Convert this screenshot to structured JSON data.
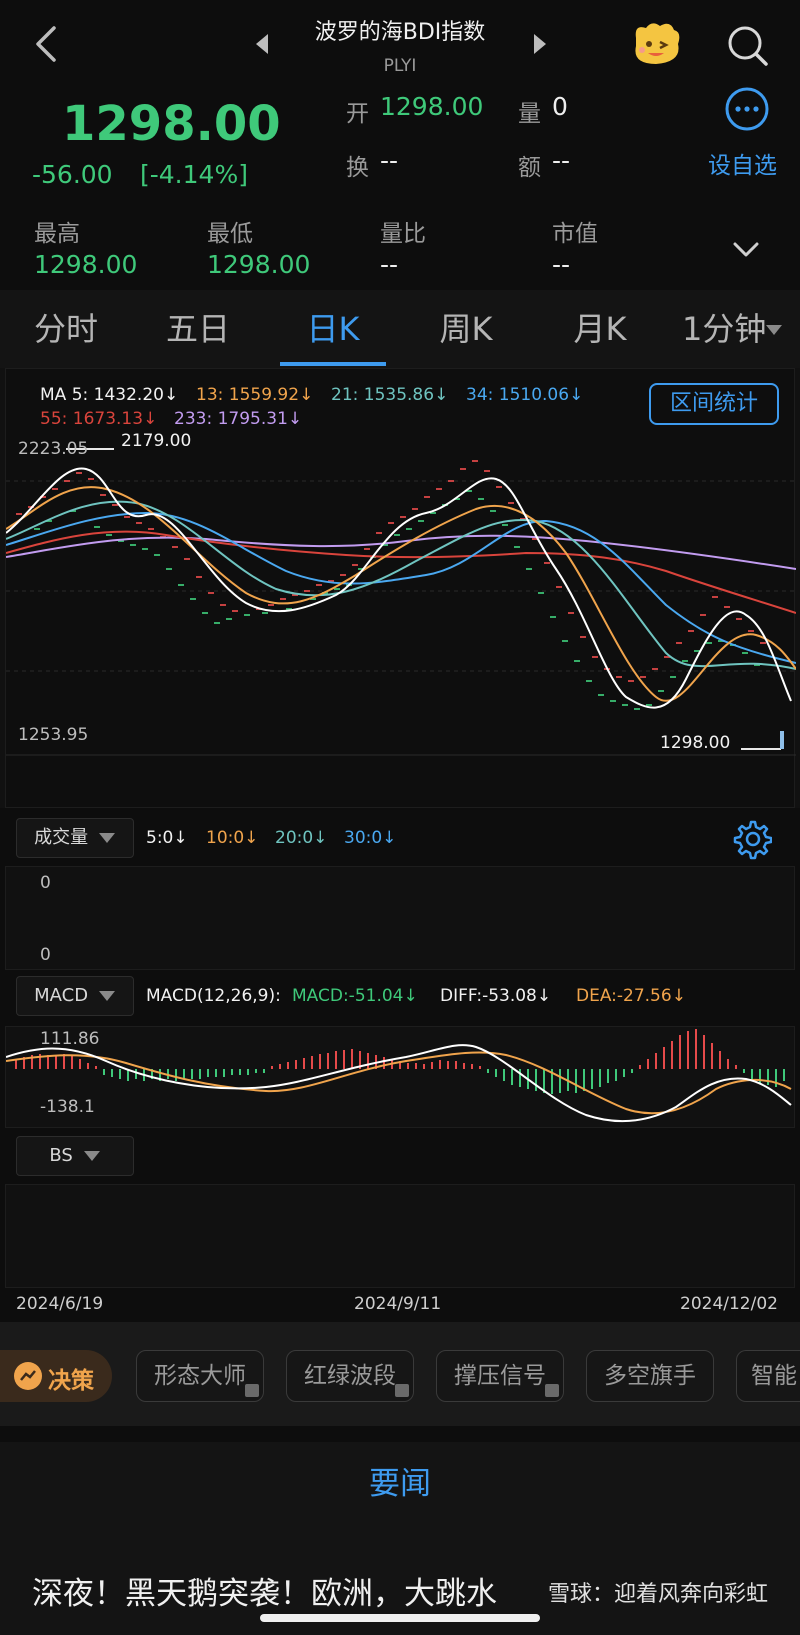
{
  "nav": {
    "title": "波罗的海BDI指数",
    "code": "PLYI"
  },
  "quote": {
    "price": "1298.00",
    "change": "-56.00",
    "change_pct": "[-4.14%]",
    "open_label": "开",
    "open_value": "1298.00",
    "vol_label": "量",
    "vol_value": "0",
    "turnover_label": "换",
    "turnover_value": "--",
    "amount_label": "额",
    "amount_value": "--",
    "watch_label": "设自选",
    "high_label": "最高",
    "high_value": "1298.00",
    "low_label": "最低",
    "low_value": "1298.00",
    "vol_ratio_label": "量比",
    "vol_ratio_value": "--",
    "mktcap_label": "市值",
    "mktcap_value": "--"
  },
  "tabs": [
    "分时",
    "五日",
    "日K",
    "周K",
    "月K",
    "1分钟"
  ],
  "active_tab": "日K",
  "ma": {
    "ma5": "MA 5: 1432.20↓",
    "ma13": "13: 1559.92↓",
    "ma21": "21: 1535.86↓",
    "ma34": "34: 1510.06↓",
    "ma55": "55: 1673.13↓",
    "ma233": "233: 1795.31↓"
  },
  "range_btn": "区间统计",
  "price_axis": {
    "top": "2223.05",
    "bottom": "1253.95",
    "max_label": "2179.00",
    "last_label": "1298.00"
  },
  "volume": {
    "selector": "成交量",
    "v5": "5:0↓",
    "v10": "10:0↓",
    "v20": "20:0↓",
    "v30": "30:0↓",
    "top": "0",
    "bottom": "0"
  },
  "macd": {
    "selector": "MACD",
    "params": "MACD(12,26,9):",
    "macd": "MACD:-51.04↓",
    "diff": "DIFF:-53.08↓",
    "dea": "DEA:-27.56↓",
    "top": "111.86",
    "bottom": "-138.1"
  },
  "bs": {
    "selector": "BS"
  },
  "dates": [
    "2024/6/19",
    "2024/9/11",
    "2024/12/02"
  ],
  "decision": {
    "label": "决策",
    "chips": [
      "形态大师",
      "红绿波段",
      "撑压信号",
      "多空旗手",
      "智能"
    ]
  },
  "news": {
    "header": "要闻",
    "headline": "深夜！黑天鹅突袭！欧洲，大跳水"
  },
  "watermark": "雪球：迎着风奔向彩虹",
  "colors": {
    "up": "#e64a4a",
    "down": "#3fc97a",
    "accent": "#3e9bef",
    "ma5": "#ffffff",
    "ma13": "#f0a44c",
    "ma21": "#6fc4c0",
    "ma34": "#4aa8f0",
    "ma55": "#d9443c",
    "ma233": "#c29cf0"
  }
}
